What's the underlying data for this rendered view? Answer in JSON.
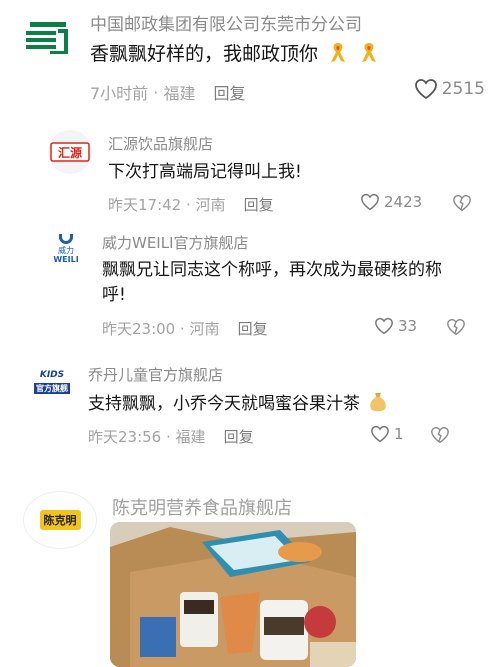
{
  "comments": [
    {
      "author": "中国邮政集团有限公司东莞市分公司",
      "text": "香飘飘好样的，我邮政顶你",
      "emojis": [
        "ribbon-icon",
        "ribbon-icon"
      ],
      "time": "7小时前",
      "location": "福建",
      "reply_label": "回复",
      "likes": "2515",
      "avatar": "china-post-logo"
    },
    {
      "author": "汇源饮品旗舰店",
      "text": "下次打高端局记得叫上我!",
      "time": "昨天17:42",
      "location": "河南",
      "reply_label": "回复",
      "likes": "2423",
      "avatar": "huiyuan-logo",
      "logo_text": "汇源"
    },
    {
      "author": "威力WEILI官方旗舰店",
      "text": "飘飘兄让同志这个称呼，再次成为最硬核的称呼!",
      "time": "昨天23:00",
      "location": "河南",
      "reply_label": "回复",
      "likes": "33",
      "avatar": "weili-logo",
      "logo_text_cn": "威力",
      "logo_text_en": "WEILI"
    },
    {
      "author": "乔丹儿童官方旗舰店",
      "text": "支持飘飘，小乔今天就喝蜜谷果汁茶",
      "emojis": [
        "money-bag-icon"
      ],
      "time": "昨天23:56",
      "location": "福建",
      "reply_label": "回复",
      "likes": "1",
      "avatar": "qiaodan-kids-logo",
      "logo_text_top": "KIDS",
      "logo_text_bottom": "官方旗舰"
    },
    {
      "author": "陈克明营养食品旗舰店",
      "avatar": "chenkeming-logo",
      "logo_text": "陈克明",
      "image": "product-box-photo"
    }
  ],
  "colors": {
    "china_post_green": "#0b7f45",
    "huiyuan_red": "#d8261c",
    "weili_blue": "#1f5fa8",
    "qiaodan_blue": "#1c3f94",
    "chenkeming_yellow": "#f2c318"
  }
}
